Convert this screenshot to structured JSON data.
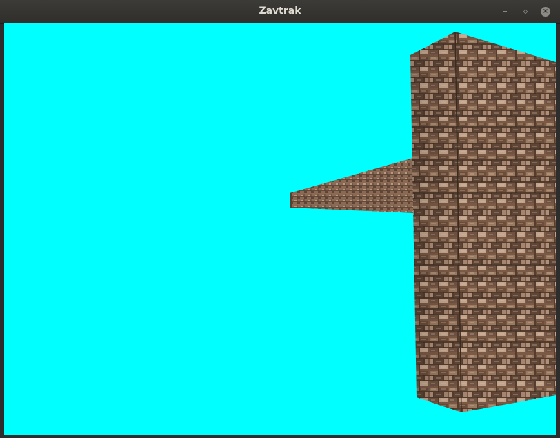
{
  "window": {
    "title": "Zavtrak",
    "minimize_icon": "minimize-icon",
    "maximize_icon": "maximize-icon",
    "close_icon": "close-icon",
    "close_glyph": "×"
  },
  "scene": {
    "sky_color": "#00ffff",
    "brick_base_color": "#7a5a45",
    "brick_mortar_color": "#3a2a20",
    "brick_highlight_color": "#c9a88e"
  }
}
